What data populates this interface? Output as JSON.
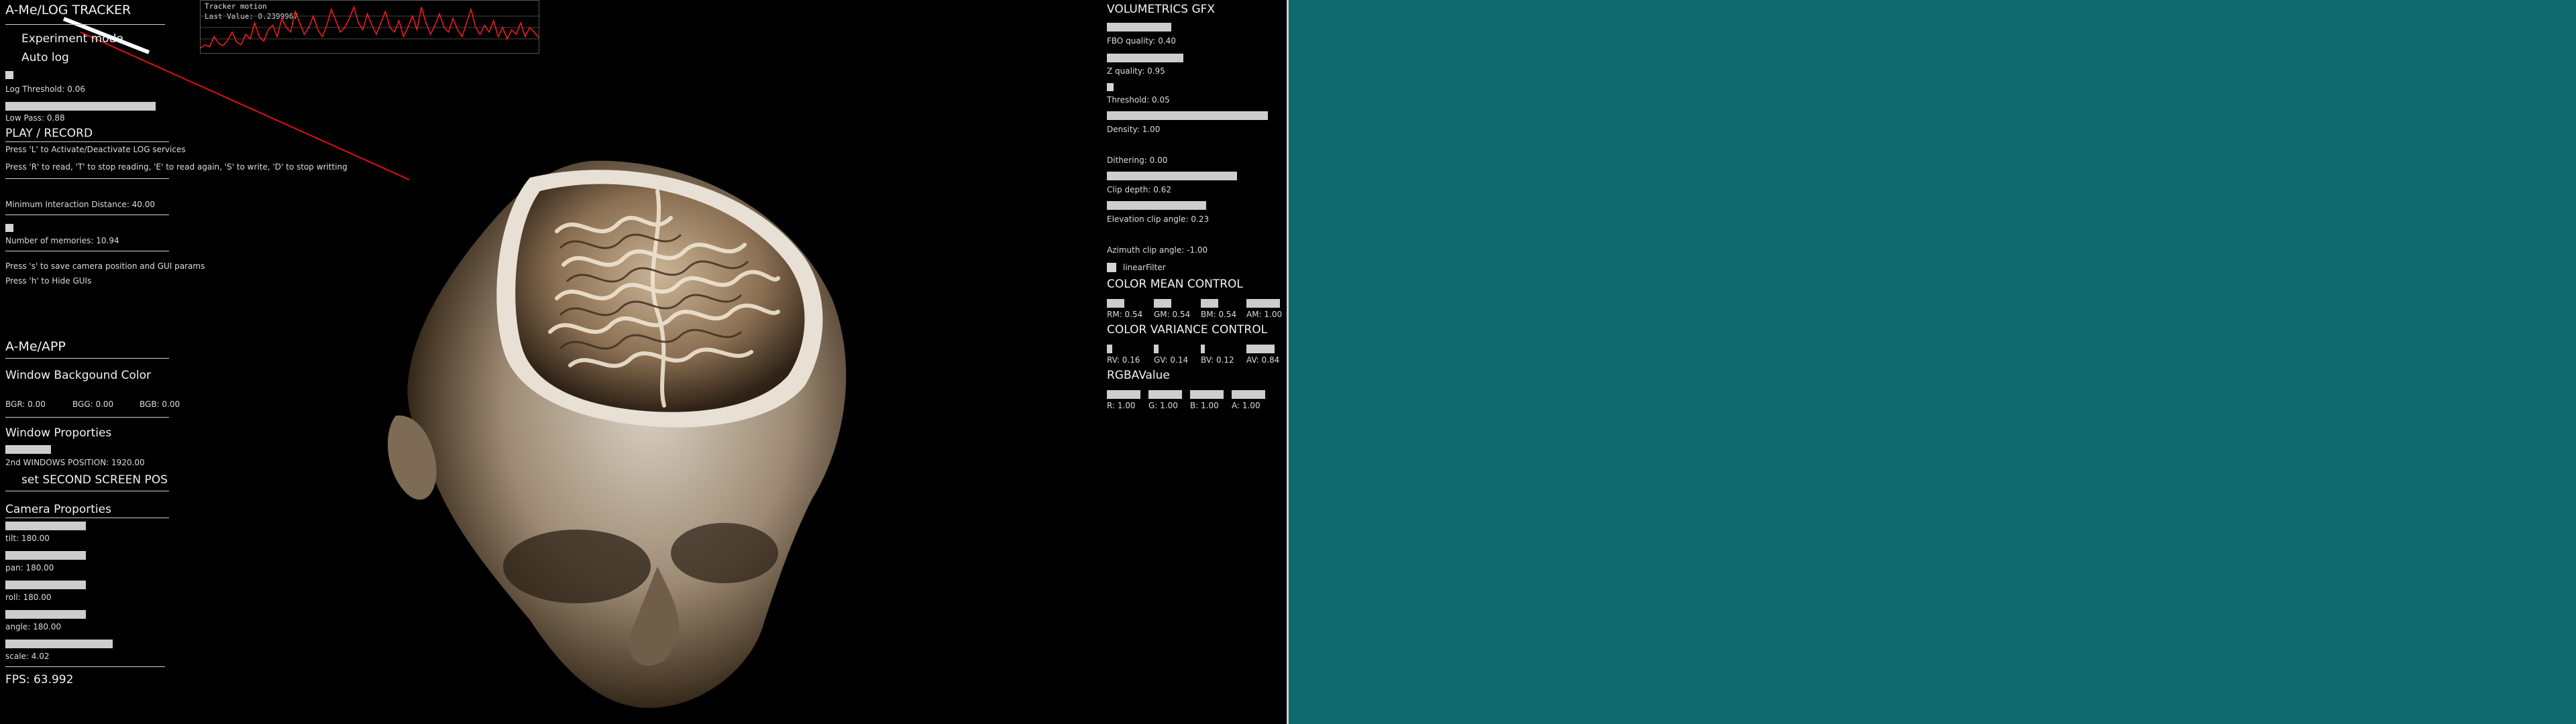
{
  "log_tracker": {
    "title": "A-Me/LOG TRACKER",
    "experiment_mode": "Experiment mode",
    "auto_log": "Auto log",
    "log_threshold": "Log Threshold: 0.06",
    "low_pass": "Low Pass: 0.88",
    "play_record": "PLAY / RECORD",
    "instr_l": "Press 'L' to Activate/Deactivate LOG services",
    "instr_r": "Press 'R' to read, 'T' to stop reading, 'E' to read again, 'S' to write, 'D' to stop writting",
    "min_distance": "Minimum Interaction Distance: 40.00",
    "num_memories": "Number of memories: 10.94",
    "instr_s": "Press 's' to save camera position and GUI params",
    "instr_h": "Press 'h' to Hide GUIs"
  },
  "tracker_graph": {
    "title": "Tracker motion",
    "last_value": "Last Value: 0.2399967",
    "color": "#ff1a1a",
    "samples": [
      0.05,
      0.12,
      0.08,
      0.3,
      0.15,
      0.1,
      0.22,
      0.4,
      0.18,
      0.12,
      0.35,
      0.25,
      0.6,
      0.3,
      0.2,
      0.45,
      0.55,
      0.3,
      0.7,
      0.5,
      0.4,
      0.85,
      0.6,
      0.35,
      0.5,
      0.75,
      0.45,
      0.3,
      0.55,
      0.9,
      0.65,
      0.4,
      0.5,
      0.7,
      0.95,
      0.6,
      0.45,
      0.8,
      0.55,
      0.35,
      0.6,
      0.85,
      0.5,
      0.4,
      0.65,
      0.3,
      0.5,
      0.75,
      0.45,
      0.95,
      0.6,
      0.35,
      0.55,
      0.8,
      0.5,
      0.4,
      0.7,
      0.45,
      0.3,
      0.6,
      0.9,
      0.5,
      0.35,
      0.55,
      0.4,
      0.65,
      0.3,
      0.5,
      0.25,
      0.45,
      0.35,
      0.6,
      0.3,
      0.5,
      0.4,
      0.28
    ]
  },
  "app_panel": {
    "title": "A-Me/APP",
    "bg_color_label": "Window Backgound Color",
    "bgr": "BGR: 0.00",
    "bgg": "BGG: 0.00",
    "bgb": "BGB: 0.00",
    "window_props": "Window Proporties",
    "second_pos": "2nd WINDOWS POSITION: 1920.00",
    "set_second": "set SECOND SCREEN POS",
    "camera_props": "Camera Proporties",
    "tilt": "tilt: 180.00",
    "pan": "pan: 180.00",
    "roll": "roll: 180.00",
    "angle": "angle: 180.00",
    "scale": "scale: 4.02",
    "fps": "FPS: 63.992"
  },
  "volumetrics": {
    "title": "VOLUMETRICS GFX",
    "fbo_quality": "FBO quality: 0.40",
    "z_quality": "Z quality: 0.95",
    "threshold": "Threshold: 0.05",
    "density": "Density: 1.00",
    "dithering": "Dithering: 0.00",
    "clip_depth": "Clip depth: 0.62",
    "elevation": "Elevation clip angle: 0.23",
    "azimuth": "Azimuth clip angle: -1.00",
    "linear_filter": "linearFilter",
    "color_mean": "COLOR MEAN CONTROL",
    "rm": "RM: 0.54",
    "gm": "GM: 0.54",
    "bm": "BM: 0.54",
    "am": "AM: 1.00",
    "color_variance": "COLOR VARIANCE CONTROL",
    "rv": "RV: 0.16",
    "gv": "GV: 0.14",
    "bv": "BV: 0.12",
    "av": "AV: 0.84",
    "rgba": "RGBAValue",
    "r": "R: 1.00",
    "g": "G: 1.00",
    "b": "B: 1.00",
    "a": "A: 1.00"
  },
  "colors": {
    "app_bg": "#000000",
    "desktop_bg": "#0f6a6f",
    "ui_text": "#e6e6e6",
    "graph_line": "#ff1a1a"
  }
}
